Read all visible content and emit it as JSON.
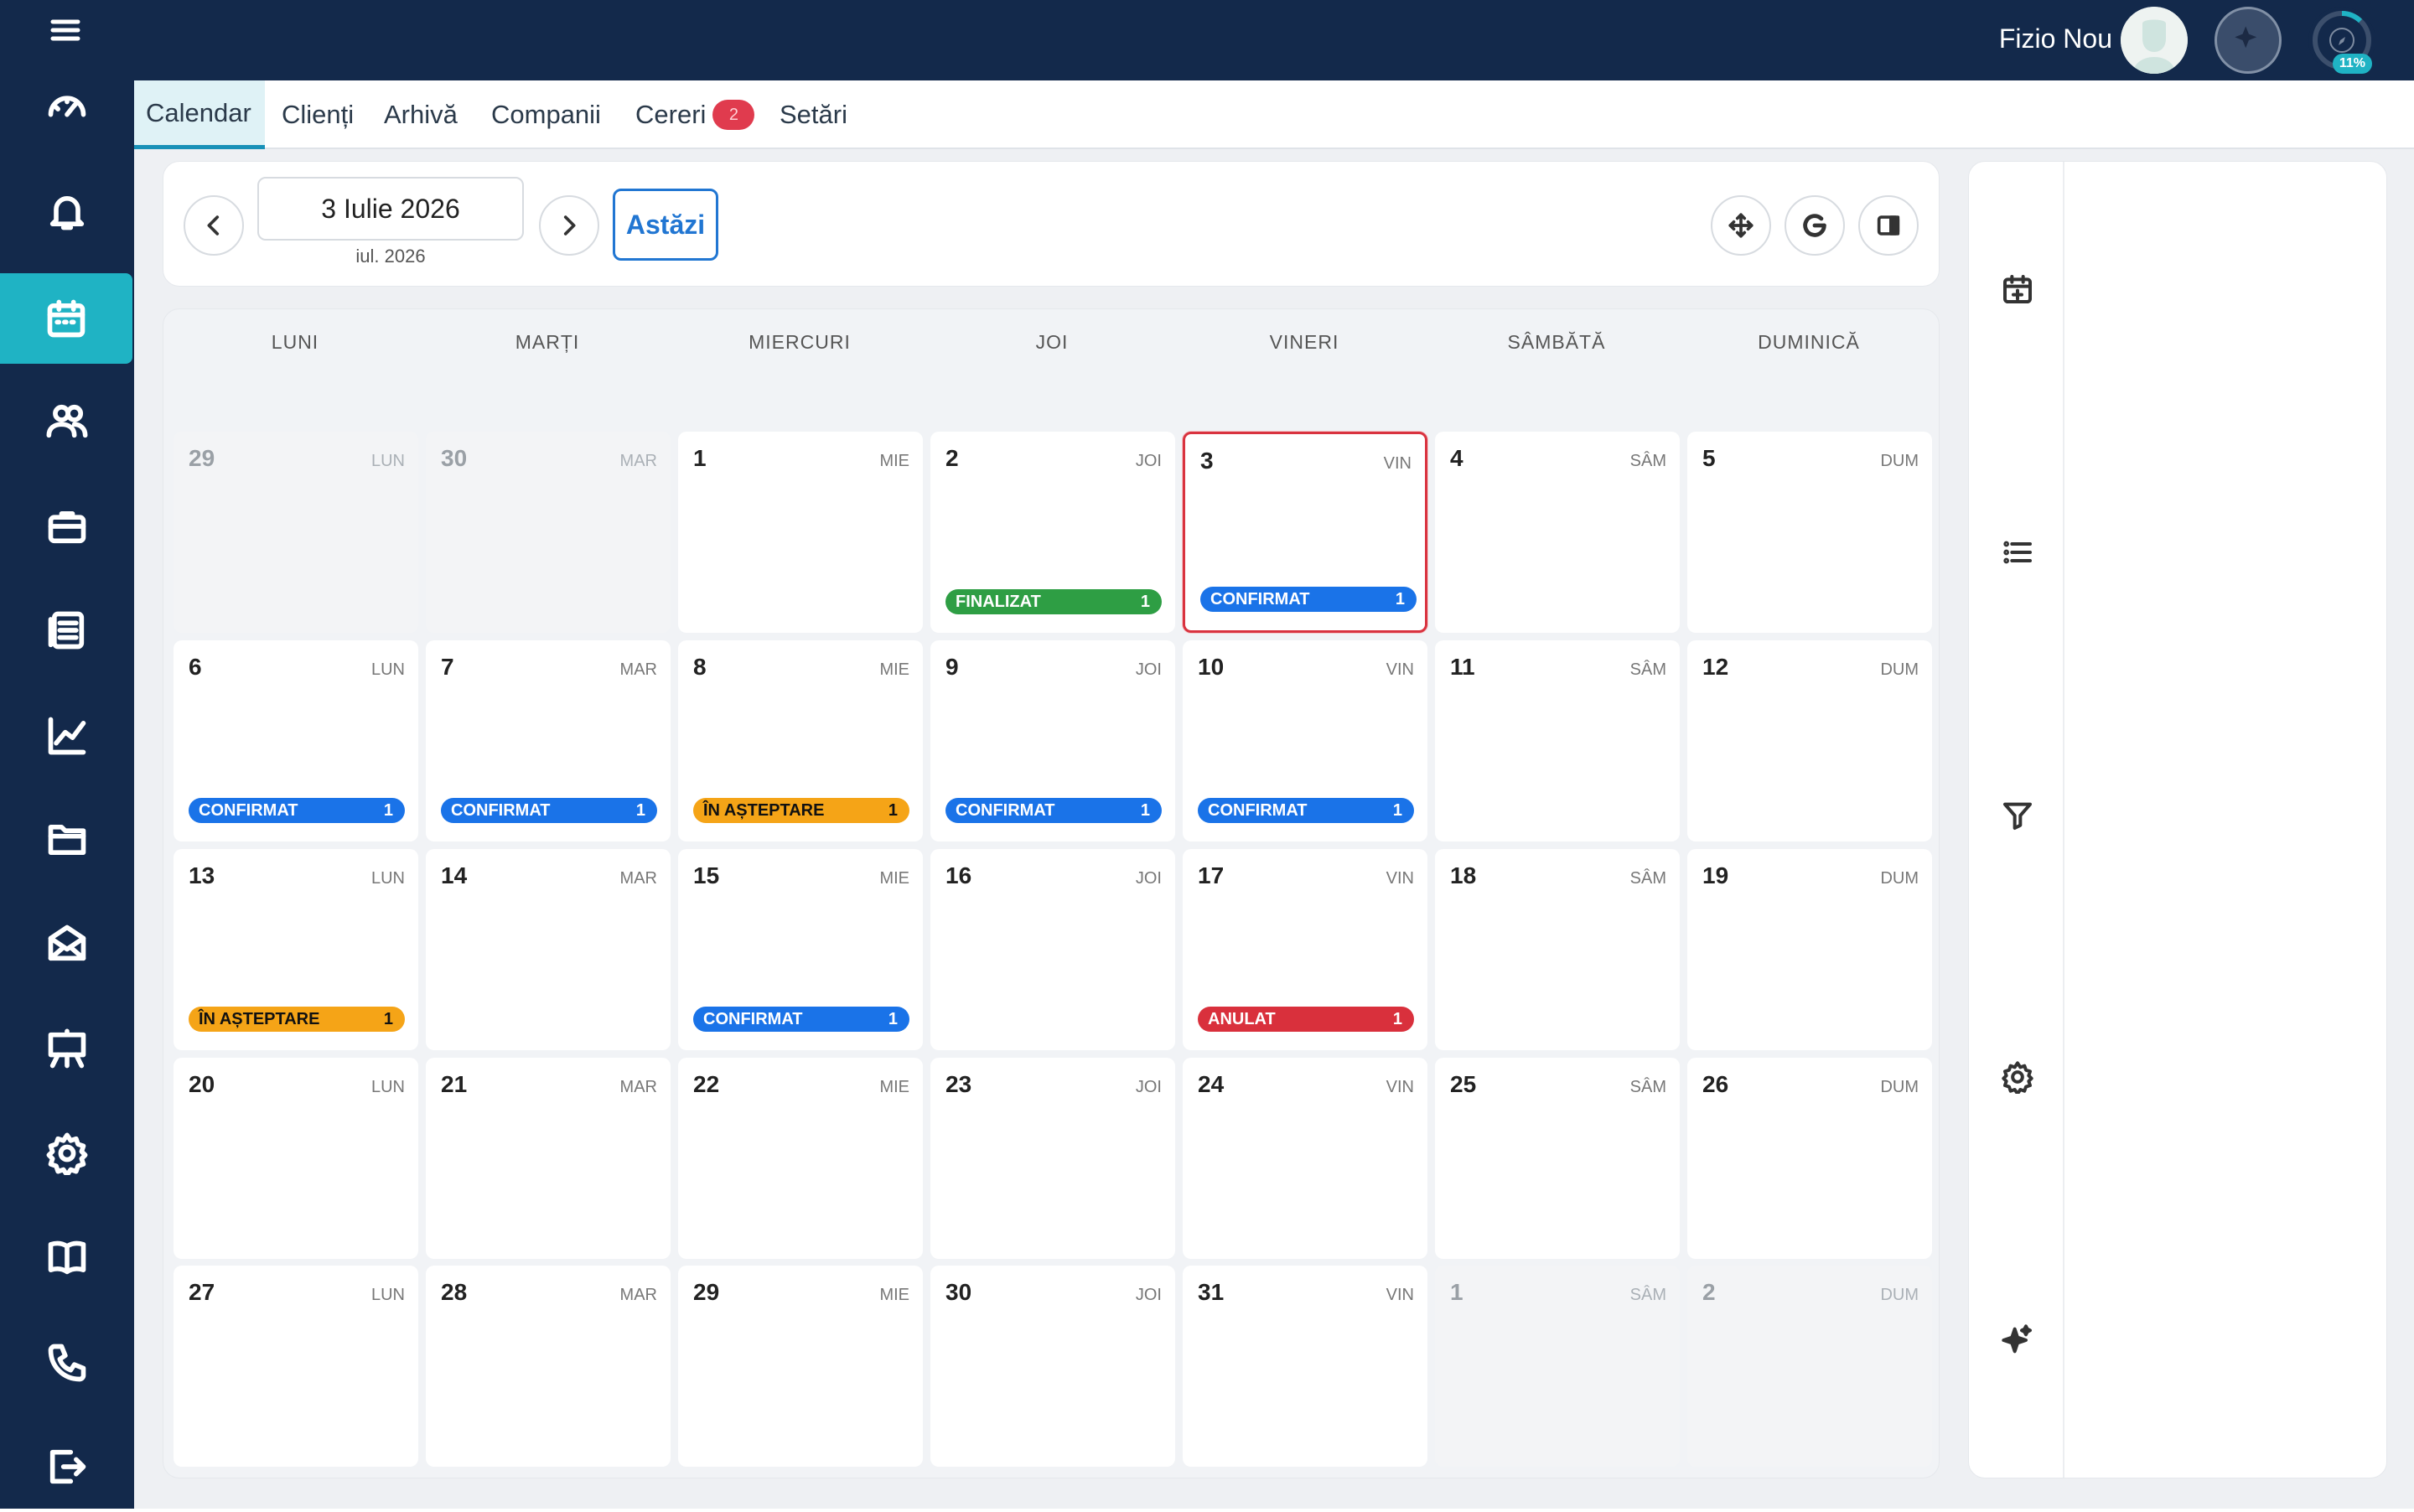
{
  "user": {
    "name": "Fizio Nou",
    "progress": "11%"
  },
  "tabs": [
    {
      "label": "Calendar",
      "active": true
    },
    {
      "label": "Clienți"
    },
    {
      "label": "Arhivă"
    },
    {
      "label": "Companii"
    },
    {
      "label": "Cereri",
      "badge": "2"
    },
    {
      "label": "Setări"
    }
  ],
  "sidebar_icons": [
    "dashboard-icon",
    "bell-icon",
    "calendar-icon",
    "users-icon",
    "briefcase-icon",
    "document-list-icon",
    "chart-icon",
    "folder-icon",
    "mail-icon",
    "easel-icon",
    "gear-icon",
    "book-icon",
    "phone-icon",
    "logout-icon"
  ],
  "nav": {
    "date": "3 Iulie 2026",
    "month": "iul. 2026",
    "today": "Astăzi"
  },
  "weekdays": [
    "LUNI",
    "MARȚI",
    "MIERCURI",
    "JOI",
    "VINERI",
    "SÂMBĂTĂ",
    "DUMINICĂ"
  ],
  "status_colors": {
    "CONFIRMAT": "#1a73e8",
    "FINALIZAT": "#2e9e44",
    "ÎN AȘTEPTARE": "#f5a417",
    "ANULAT": "#d9303c"
  },
  "weeks": [
    [
      {
        "day": "29",
        "abbr": "LUN",
        "muted": true
      },
      {
        "day": "30",
        "abbr": "MAR",
        "muted": true
      },
      {
        "day": "1",
        "abbr": "MIE"
      },
      {
        "day": "2",
        "abbr": "JOI",
        "status": "FINALIZAT",
        "count": "1"
      },
      {
        "day": "3",
        "abbr": "VIN",
        "status": "CONFIRMAT",
        "count": "1",
        "today": true
      },
      {
        "day": "4",
        "abbr": "SÂM"
      },
      {
        "day": "5",
        "abbr": "DUM"
      }
    ],
    [
      {
        "day": "6",
        "abbr": "LUN",
        "status": "CONFIRMAT",
        "count": "1"
      },
      {
        "day": "7",
        "abbr": "MAR",
        "status": "CONFIRMAT",
        "count": "1"
      },
      {
        "day": "8",
        "abbr": "MIE",
        "status": "ÎN AȘTEPTARE",
        "count": "1"
      },
      {
        "day": "9",
        "abbr": "JOI",
        "status": "CONFIRMAT",
        "count": "1"
      },
      {
        "day": "10",
        "abbr": "VIN",
        "status": "CONFIRMAT",
        "count": "1"
      },
      {
        "day": "11",
        "abbr": "SÂM"
      },
      {
        "day": "12",
        "abbr": "DUM"
      }
    ],
    [
      {
        "day": "13",
        "abbr": "LUN",
        "status": "ÎN AȘTEPTARE",
        "count": "1"
      },
      {
        "day": "14",
        "abbr": "MAR"
      },
      {
        "day": "15",
        "abbr": "MIE",
        "status": "CONFIRMAT",
        "count": "1"
      },
      {
        "day": "16",
        "abbr": "JOI"
      },
      {
        "day": "17",
        "abbr": "VIN",
        "status": "ANULAT",
        "count": "1"
      },
      {
        "day": "18",
        "abbr": "SÂM"
      },
      {
        "day": "19",
        "abbr": "DUM"
      }
    ],
    [
      {
        "day": "20",
        "abbr": "LUN"
      },
      {
        "day": "21",
        "abbr": "MAR"
      },
      {
        "day": "22",
        "abbr": "MIE"
      },
      {
        "day": "23",
        "abbr": "JOI"
      },
      {
        "day": "24",
        "abbr": "VIN"
      },
      {
        "day": "25",
        "abbr": "SÂM"
      },
      {
        "day": "26",
        "abbr": "DUM"
      }
    ],
    [
      {
        "day": "27",
        "abbr": "LUN"
      },
      {
        "day": "28",
        "abbr": "MAR"
      },
      {
        "day": "29",
        "abbr": "MIE"
      },
      {
        "day": "30",
        "abbr": "JOI"
      },
      {
        "day": "31",
        "abbr": "VIN"
      },
      {
        "day": "1",
        "abbr": "SÂM",
        "muted": true
      },
      {
        "day": "2",
        "abbr": "DUM",
        "muted": true
      }
    ]
  ],
  "right_panel_icons": [
    "calendar-add-icon",
    "list-icon",
    "filter-icon",
    "settings-icon",
    "sparkles-icon"
  ],
  "toolbar_icons": [
    "move-icon",
    "google-icon",
    "panel-toggle-icon"
  ]
}
